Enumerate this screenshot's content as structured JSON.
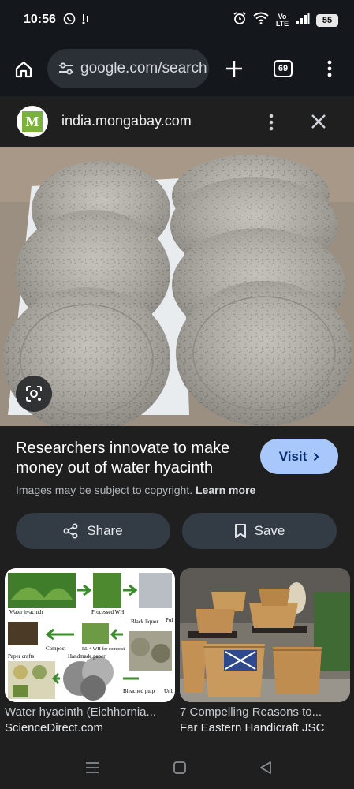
{
  "status_bar": {
    "time": "10:56",
    "network": "Vo LTE",
    "battery": "55"
  },
  "browser": {
    "url": "google.com/search",
    "tab_count": "69"
  },
  "source": {
    "logo_letter": "M",
    "domain": "india.mongabay.com"
  },
  "result": {
    "title": "Researchers innovate to make money out of water hyacinth",
    "visit_label": "Visit",
    "copyright_text": "Images may be subject to copyright.",
    "learn_more": "Learn more",
    "share_label": "Share",
    "save_label": "Save"
  },
  "related": [
    {
      "title": "Water hyacinth (Eichhornia...",
      "source": "ScienceDirect.com",
      "labels": [
        "Water hyacinth",
        "Processed WH",
        "Black liquor",
        "Pul",
        "Compost",
        "RL + WH for compost",
        "Paper crafts",
        "Handmade paper",
        "Bleached pulp",
        "Unb"
      ]
    },
    {
      "title": "7 Compelling Reasons to...",
      "source": "Far Eastern Handicraft JSC"
    }
  ],
  "colors": {
    "background": "#1f1f1f",
    "toolbar": "#14171b",
    "visit_button": "#a8c7fa",
    "pill_button": "#333b45"
  },
  "icons": [
    "whatsapp-icon",
    "signal-icon",
    "alarm-icon",
    "wifi-icon",
    "cellular-icon",
    "home-icon",
    "tune-icon",
    "plus-icon",
    "tab-switcher-icon",
    "more-vert-icon",
    "close-icon",
    "lens-icon",
    "chevron-right-icon",
    "share-icon",
    "bookmark-icon",
    "recents-icon",
    "nav-home-icon",
    "back-icon"
  ]
}
